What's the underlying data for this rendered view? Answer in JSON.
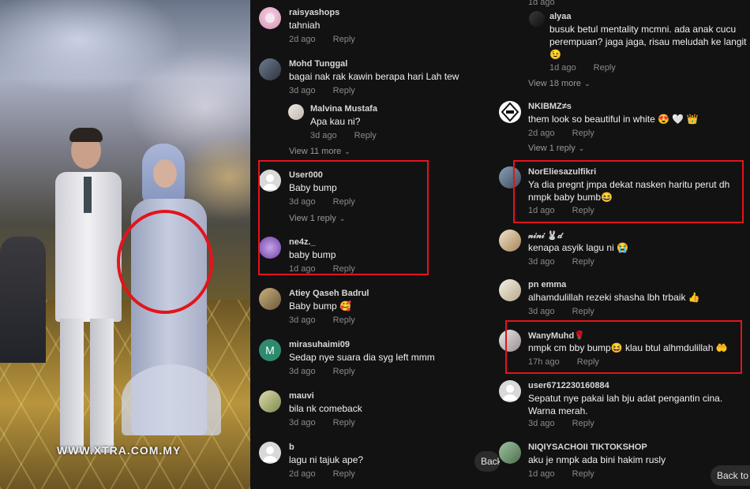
{
  "photo": {
    "watermark": "WWW.XTRA.COM.MY",
    "highlight_color": "#e3141b"
  },
  "left_column": [
    {
      "id": "c1",
      "username": "raisyashops",
      "text": "tahniah",
      "time": "2d ago",
      "reply": "Reply",
      "avatar": "pink-avatar-icon"
    },
    {
      "id": "c2",
      "username": "Mohd Tunggal",
      "text": "bagai nak rak kawin berapa hari Lah tew",
      "time": "3d ago",
      "reply": "Reply",
      "avatar": "photo-avatar-icon"
    },
    {
      "id": "c3",
      "username": "Malvina Mustafa",
      "text": "Apa kau ni?",
      "time": "3d ago",
      "reply": "Reply",
      "avatar": "photo-avatar-icon",
      "is_reply": true
    },
    {
      "id": "c4",
      "username": "User000",
      "text": "Baby bump",
      "time": "3d ago",
      "reply": "Reply",
      "avatar": "default-user-icon"
    },
    {
      "id": "c5",
      "username": "ne4z._",
      "text": "baby bump",
      "time": "1d ago",
      "reply": "Reply",
      "avatar": "purple-avatar-icon"
    },
    {
      "id": "c6",
      "username": "Atiey Qaseh Badrul",
      "text": "Baby bump 🥰",
      "time": "3d ago",
      "reply": "Reply",
      "avatar": "photo-avatar-icon"
    },
    {
      "id": "c7",
      "username": "mirasuhaimi09",
      "text": "Sedap nye suara dia syg left mmm",
      "time": "3d ago",
      "reply": "Reply",
      "avatar": "letter-m-avatar-icon",
      "avatar_letter": "M"
    },
    {
      "id": "c8",
      "username": "mauvi",
      "text": "bila nk comeback",
      "time": "3d ago",
      "reply": "Reply",
      "avatar": "photo-avatar-icon"
    },
    {
      "id": "c9",
      "username": "b",
      "text": "lagu ni tajuk ape?",
      "time": "2d ago",
      "reply": "Reply",
      "avatar": "default-user-icon"
    }
  ],
  "left_more": [
    {
      "label": "View 11 more"
    },
    {
      "label": "View 1 reply"
    }
  ],
  "right_column": [
    {
      "id": "r0",
      "time": "1d ago"
    },
    {
      "id": "r1",
      "username": "alyaa",
      "text": "busuk betul mentality mcmni. ada anak cucu perempuan? jaga jaga, risau meludah ke langit 😉",
      "time": "1d ago",
      "reply": "Reply",
      "avatar": "photo-avatar-icon"
    },
    {
      "id": "r2",
      "username": "NKIBMZ≠s",
      "text": "them look so beautiful in white 😍 🤍 👑",
      "time": "2d ago",
      "reply": "Reply",
      "avatar": "logo-avatar-icon"
    },
    {
      "id": "r3",
      "username": "NorEliesazulfikri",
      "text": "Ya dia pregnt jmpa dekat nasken haritu perut dh nmpk baby bumb😆",
      "time": "1d ago",
      "reply": "Reply",
      "avatar": "photo-avatar-icon"
    },
    {
      "id": "r4",
      "username": "𝓃𝒾𝓃𝒾 🐰𝒹",
      "text": "kenapa asyik lagu ni 😭",
      "time": "3d ago",
      "reply": "Reply",
      "avatar": "photo-avatar-icon"
    },
    {
      "id": "r5",
      "username": "pn emma",
      "text": "alhamdulillah rezeki shasha lbh trbaik 👍",
      "time": "3d ago",
      "reply": "Reply",
      "avatar": "photo-avatar-icon"
    },
    {
      "id": "r6",
      "username": "WanyMuhd🌹",
      "text": "nmpk cm bby bump😆 klau btul alhmdulillah 🤲",
      "time": "17h ago",
      "reply": "Reply",
      "avatar": "photo-avatar-icon"
    },
    {
      "id": "r7",
      "username": "user6712230160884",
      "text": "Sepatut nye pakai lah bju adat pengantin cina. Warna merah.",
      "time": "3d ago",
      "reply": "Reply",
      "avatar": "default-user-icon"
    },
    {
      "id": "r8",
      "username": "NIQIYSACHOII TIKTOKSHOP",
      "text": "aku je nmpk ada bini hakim rusly",
      "time": "1d ago",
      "reply": "Reply",
      "avatar": "photo-avatar-icon"
    }
  ],
  "right_more": [
    {
      "label": "View 18 more"
    },
    {
      "label": "View 1 reply"
    }
  ],
  "back_buttons": [
    {
      "label": "Back"
    },
    {
      "label": "Back to"
    }
  ]
}
